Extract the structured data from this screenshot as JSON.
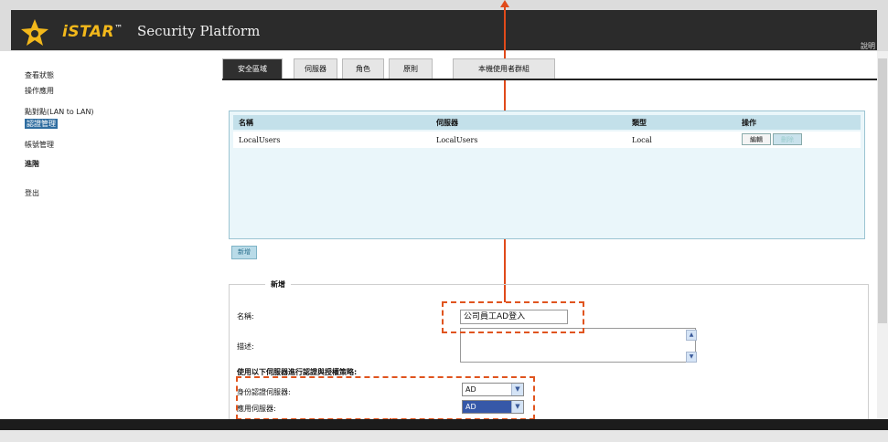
{
  "header": {
    "logo_text": "iSTAR",
    "tm": "™",
    "platform": "Security Platform",
    "help": "說明"
  },
  "sidebar": {
    "items": [
      {
        "label": "查看狀態"
      },
      {
        "label": "操作應用"
      },
      {
        "label": "點對點(LAN to LAN)"
      },
      {
        "label": "認證管理"
      },
      {
        "label": "帳號管理"
      },
      {
        "label": "進階"
      },
      {
        "label": "登出"
      }
    ]
  },
  "tabs": [
    {
      "label": "安全區域"
    },
    {
      "label": "伺服器"
    },
    {
      "label": "角色"
    },
    {
      "label": "原則"
    },
    {
      "label": "本機使用者群組"
    }
  ],
  "table": {
    "headers": [
      "名稱",
      "伺服器",
      "類型",
      "操作"
    ],
    "rows": [
      {
        "name": "LocalUsers",
        "server": "LocalUsers",
        "type": "Local",
        "edit": "編輯",
        "delete": "刪除"
      }
    ]
  },
  "add_button": "新增",
  "form": {
    "legend": "新增",
    "name_label": "名稱:",
    "name_value": "公司員工AD登入",
    "desc_label": "描述:",
    "policy_heading": "使用以下伺服器進行認證與授權策略:",
    "auth_server_label": "身份認證伺服器:",
    "auth_server_value": "AD",
    "authz_server_label": "應用伺服器:",
    "authz_server_value": "AD"
  },
  "colors": {
    "annotation": "#e04a1a",
    "logo": "#f2b81b",
    "active_nav": "#2f6da0"
  }
}
